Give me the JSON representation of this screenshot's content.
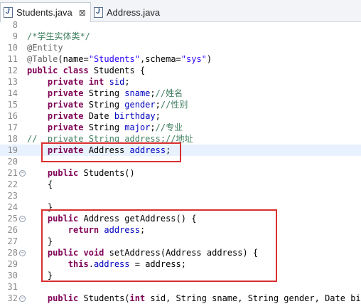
{
  "tabs": [
    {
      "label": "Students.java",
      "icon": "java-file-icon",
      "active": true,
      "close": "⊠"
    },
    {
      "label": "Address.java",
      "icon": "java-file-icon",
      "active": false
    }
  ],
  "editor": {
    "lines": [
      {
        "n": "8",
        "html": ""
      },
      {
        "n": "9",
        "html": "<span class=\"cm\">/*学生实体类*/</span>"
      },
      {
        "n": "10",
        "html": "<span class=\"ann\">@Entity</span>"
      },
      {
        "n": "11",
        "html": "<span class=\"ann\">@Table</span>(name=<span class=\"str\">\"Students\"</span>,schema=<span class=\"str\">\"sys\"</span>)"
      },
      {
        "n": "12",
        "html": "<span class=\"kw\">public class</span> Students {"
      },
      {
        "n": "13",
        "html": "    <span class=\"kw\">private int</span> <span class=\"fld\">sid</span>;"
      },
      {
        "n": "14",
        "html": "    <span class=\"kw\">private</span> String <span class=\"fld\">sname</span>;<span class=\"cm\">//姓名</span>"
      },
      {
        "n": "15",
        "html": "    <span class=\"kw\">private</span> String <span class=\"fld\">gender</span>;<span class=\"cm\">//性别</span>"
      },
      {
        "n": "16",
        "html": "    <span class=\"kw\">private</span> Date <span class=\"fld\">birthday</span>;"
      },
      {
        "n": "17",
        "html": "    <span class=\"kw\">private</span> String <span class=\"fld\">major</span>;<span class=\"cm\">//专业</span>"
      },
      {
        "n": "18",
        "html": "<span class=\"cm\">//  private String address;//地址</span>"
      },
      {
        "n": "19",
        "html": "    <span class=\"kw\">private</span> Address <span class=\"fld\">address</span>;",
        "current": true
      },
      {
        "n": "20",
        "html": ""
      },
      {
        "n": "21",
        "html": "    <span class=\"kw\">public</span> Students()",
        "fold": true
      },
      {
        "n": "22",
        "html": "    {"
      },
      {
        "n": "23",
        "html": ""
      },
      {
        "n": "24",
        "html": "    }"
      },
      {
        "n": "25",
        "html": "    <span class=\"kw\">public</span> Address getAddress() {",
        "fold": true
      },
      {
        "n": "26",
        "html": "        <span class=\"kw\">return</span> <span class=\"fld\">address</span>;"
      },
      {
        "n": "27",
        "html": "    }"
      },
      {
        "n": "28",
        "html": "    <span class=\"kw\">public void</span> setAddress(Address address) {",
        "fold": true
      },
      {
        "n": "29",
        "html": "        <span class=\"kw\">this</span>.<span class=\"fld\">address</span> = address;"
      },
      {
        "n": "30",
        "html": "    }"
      },
      {
        "n": "31",
        "html": ""
      },
      {
        "n": "32",
        "html": "    <span class=\"kw\">public</span> Students(<span class=\"kw\">int</span> sid, String sname, String gender, Date birt",
        "fold": true
      }
    ]
  }
}
